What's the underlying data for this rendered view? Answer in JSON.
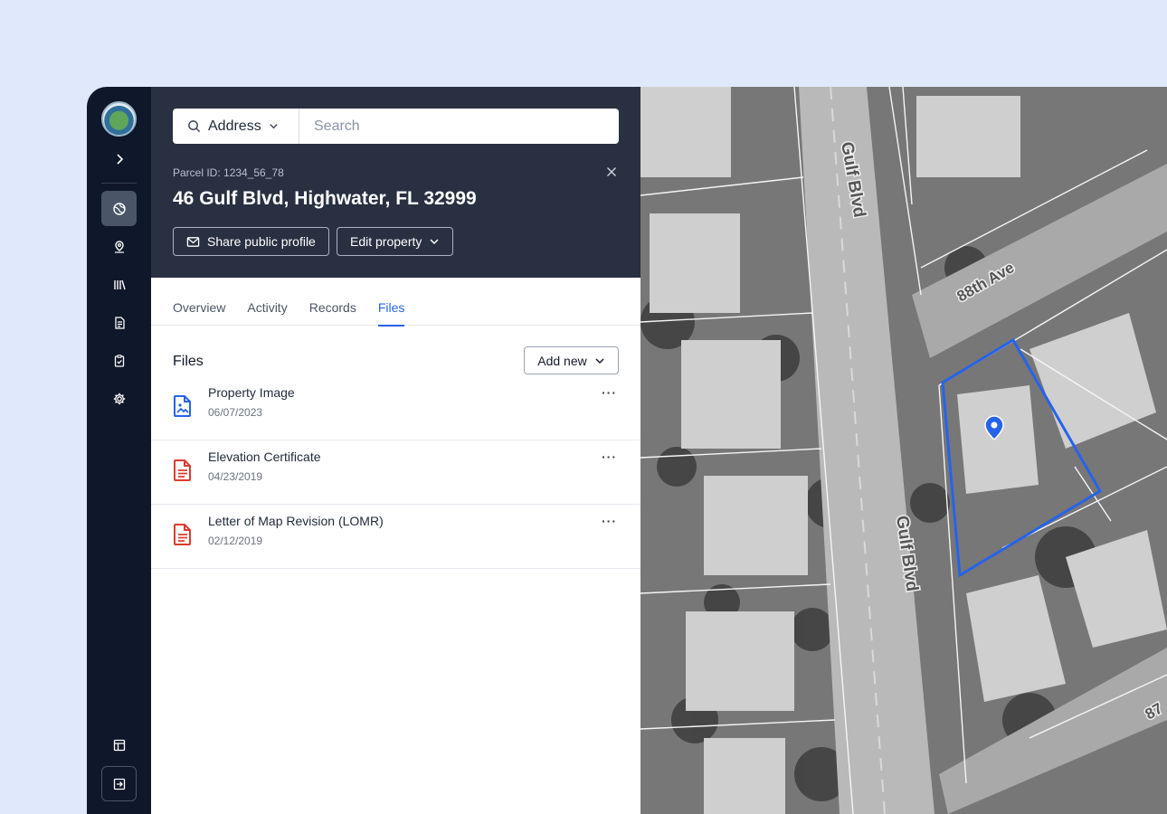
{
  "sidebar": {
    "nav": [
      {
        "icon": "globe-icon"
      },
      {
        "icon": "map-pin-icon"
      },
      {
        "icon": "library-icon"
      },
      {
        "icon": "document-icon"
      },
      {
        "icon": "clipboard-check-icon"
      },
      {
        "icon": "gear-icon"
      }
    ],
    "bottom": [
      {
        "icon": "layout-icon"
      },
      {
        "icon": "logout-icon"
      }
    ]
  },
  "search": {
    "type_label": "Address",
    "placeholder": "Search"
  },
  "property": {
    "parcel_id": "Parcel ID: 1234_56_78",
    "address": "46 Gulf Blvd, Highwater, FL 32999",
    "share_label": "Share public profile",
    "edit_label": "Edit property"
  },
  "tabs": [
    "Overview",
    "Activity",
    "Records",
    "Files"
  ],
  "active_tab": "Files",
  "files": {
    "title": "Files",
    "add_new_label": "Add new",
    "items": [
      {
        "name": "Property Image",
        "date": "06/07/2023",
        "icon": "image-file-icon",
        "color": "#2563eb"
      },
      {
        "name": "Elevation Certificate",
        "date": "04/23/2019",
        "icon": "document-file-icon",
        "color": "#dc3b2f"
      },
      {
        "name": "Letter of Map Revision (LOMR)",
        "date": "02/12/2019",
        "icon": "document-file-icon",
        "color": "#dc3b2f"
      }
    ],
    "more_label": "···"
  },
  "map": {
    "street_labels": [
      "Gulf Blvd",
      "88th Ave",
      "Gulf Blvd",
      "87"
    ],
    "highlight_color": "#2563eb"
  }
}
